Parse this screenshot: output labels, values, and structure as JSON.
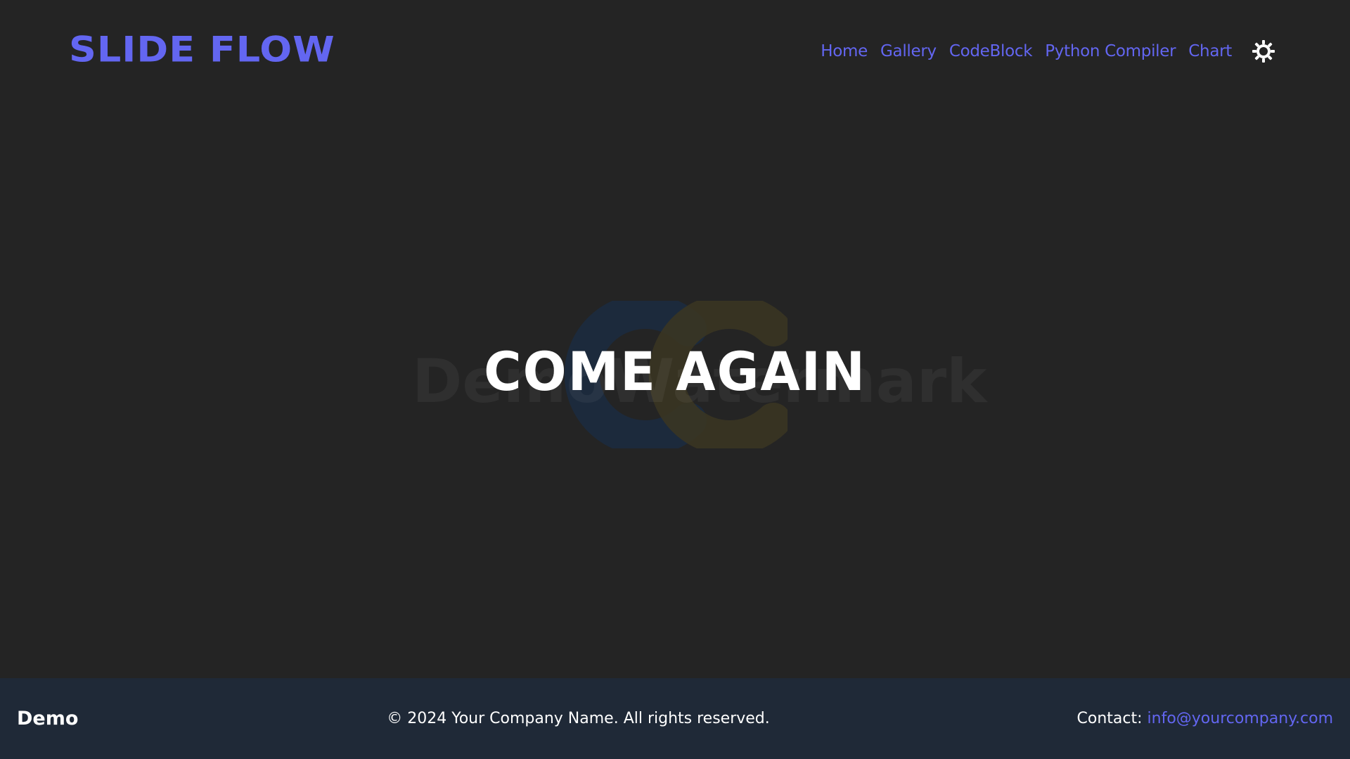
{
  "header": {
    "logo": "Slide Flow",
    "nav": [
      "Home",
      "Gallery",
      "CodeBlock",
      "Python Compiler",
      "Chart"
    ],
    "theme_toggle_icon": "sun-icon"
  },
  "hero": {
    "title": "Come Again",
    "watermark_text": "DemoWatermark",
    "watermark_icon": "cc-logo-icon"
  },
  "footer": {
    "brand": "Demo",
    "copyright": "© 2024 Your Company Name. All rights reserved.",
    "contact_label": "Contact:",
    "contact_email": "info@yourcompany.com"
  },
  "colors": {
    "background": "#242424",
    "accent": "#6366f1",
    "footer_bg": "#1f2937",
    "text": "#ffffff"
  }
}
